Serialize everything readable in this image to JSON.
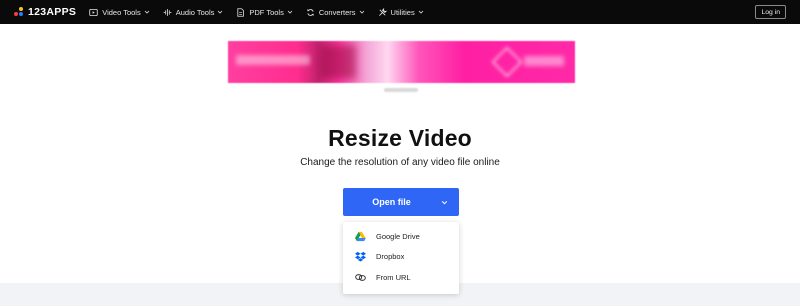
{
  "brand": {
    "logo_text": "123APPS"
  },
  "nav": {
    "items": [
      {
        "label": "Video Tools",
        "icon": "video-icon"
      },
      {
        "label": "Audio Tools",
        "icon": "audio-wave-icon"
      },
      {
        "label": "PDF Tools",
        "icon": "pdf-icon"
      },
      {
        "label": "Converters",
        "icon": "convert-icon"
      },
      {
        "label": "Utilities",
        "icon": "tools-icon"
      }
    ],
    "login_label": "Log in"
  },
  "main": {
    "title": "Resize Video",
    "subtitle": "Change the resolution of any video file online",
    "open_button_label": "Open file"
  },
  "dropdown": {
    "items": [
      {
        "label": "Google Drive",
        "icon": "google-drive-icon"
      },
      {
        "label": "Dropbox",
        "icon": "dropbox-icon"
      },
      {
        "label": "From URL",
        "icon": "link-icon"
      }
    ]
  },
  "colors": {
    "navbar_bg": "#0a0a0a",
    "accent": "#2f66f5",
    "bottom_band": "#f1f3f6"
  }
}
